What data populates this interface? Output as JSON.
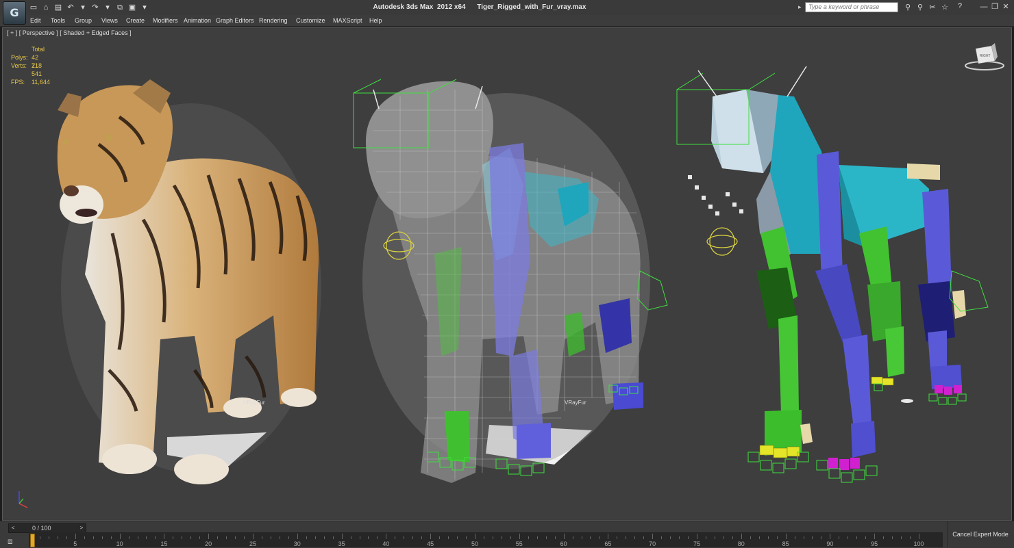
{
  "window": {
    "app_title": "Autodesk 3ds Max  2012 x64",
    "file_name": "Tiger_Rigged_with_Fur_vray.max",
    "app_icon_glyph": "G"
  },
  "quick_access": [
    {
      "name": "new-file-icon",
      "glyph": "▭"
    },
    {
      "name": "open-folder-icon",
      "glyph": "⌂"
    },
    {
      "name": "save-icon",
      "glyph": "▤"
    },
    {
      "name": "undo-icon",
      "glyph": "↶"
    },
    {
      "name": "undo-dropdown-icon",
      "glyph": "▾"
    },
    {
      "name": "redo-icon",
      "glyph": "↷"
    },
    {
      "name": "redo-dropdown-icon",
      "glyph": "▾"
    },
    {
      "name": "hold-icon",
      "glyph": "⧉"
    },
    {
      "name": "project-folder-icon",
      "glyph": "▣"
    },
    {
      "name": "quick-access-dropdown-icon",
      "glyph": "▾"
    }
  ],
  "search": {
    "placeholder": "Type a keyword or phrase"
  },
  "toolbar_right_icons": [
    {
      "name": "binoculars-icon",
      "glyph": "⚲"
    },
    {
      "name": "binoculars-alt-icon",
      "glyph": "⚲"
    },
    {
      "name": "tools-icon",
      "glyph": "✂"
    },
    {
      "name": "star-icon",
      "glyph": "☆"
    }
  ],
  "help_glyph": "?",
  "window_controls": {
    "minimize": "—",
    "restore": "❐",
    "close": "✕"
  },
  "menu": [
    "Edit",
    "Tools",
    "Group",
    "Views",
    "Create",
    "Modifiers",
    "Animation",
    "Graph Editors",
    "Rendering",
    "Customize",
    "MAXScript",
    "Help"
  ],
  "viewport": {
    "label": "[ + ] [ Perspective ] [ Shaded + Edged Faces ]",
    "stats_header": "Total",
    "polys_label": "Polys:",
    "polys_value": "42 718",
    "verts_label": "Verts:",
    "verts_value": "21 541",
    "fps_label": "FPS:",
    "fps_value": "11,644",
    "fur_label_1": "VRayFur",
    "fur_label_2": "VRayFur",
    "viewcube_label": "RIGHT"
  },
  "timeline": {
    "frame_label": "0 / 100",
    "prev_glyph": "<",
    "next_glyph": ">",
    "ticks": [
      5,
      10,
      15,
      20,
      25,
      30,
      35,
      40,
      45,
      50,
      55,
      60,
      65,
      70,
      75,
      80,
      85,
      90,
      95,
      100
    ],
    "cancel_label": "Cancel Expert Mode"
  }
}
